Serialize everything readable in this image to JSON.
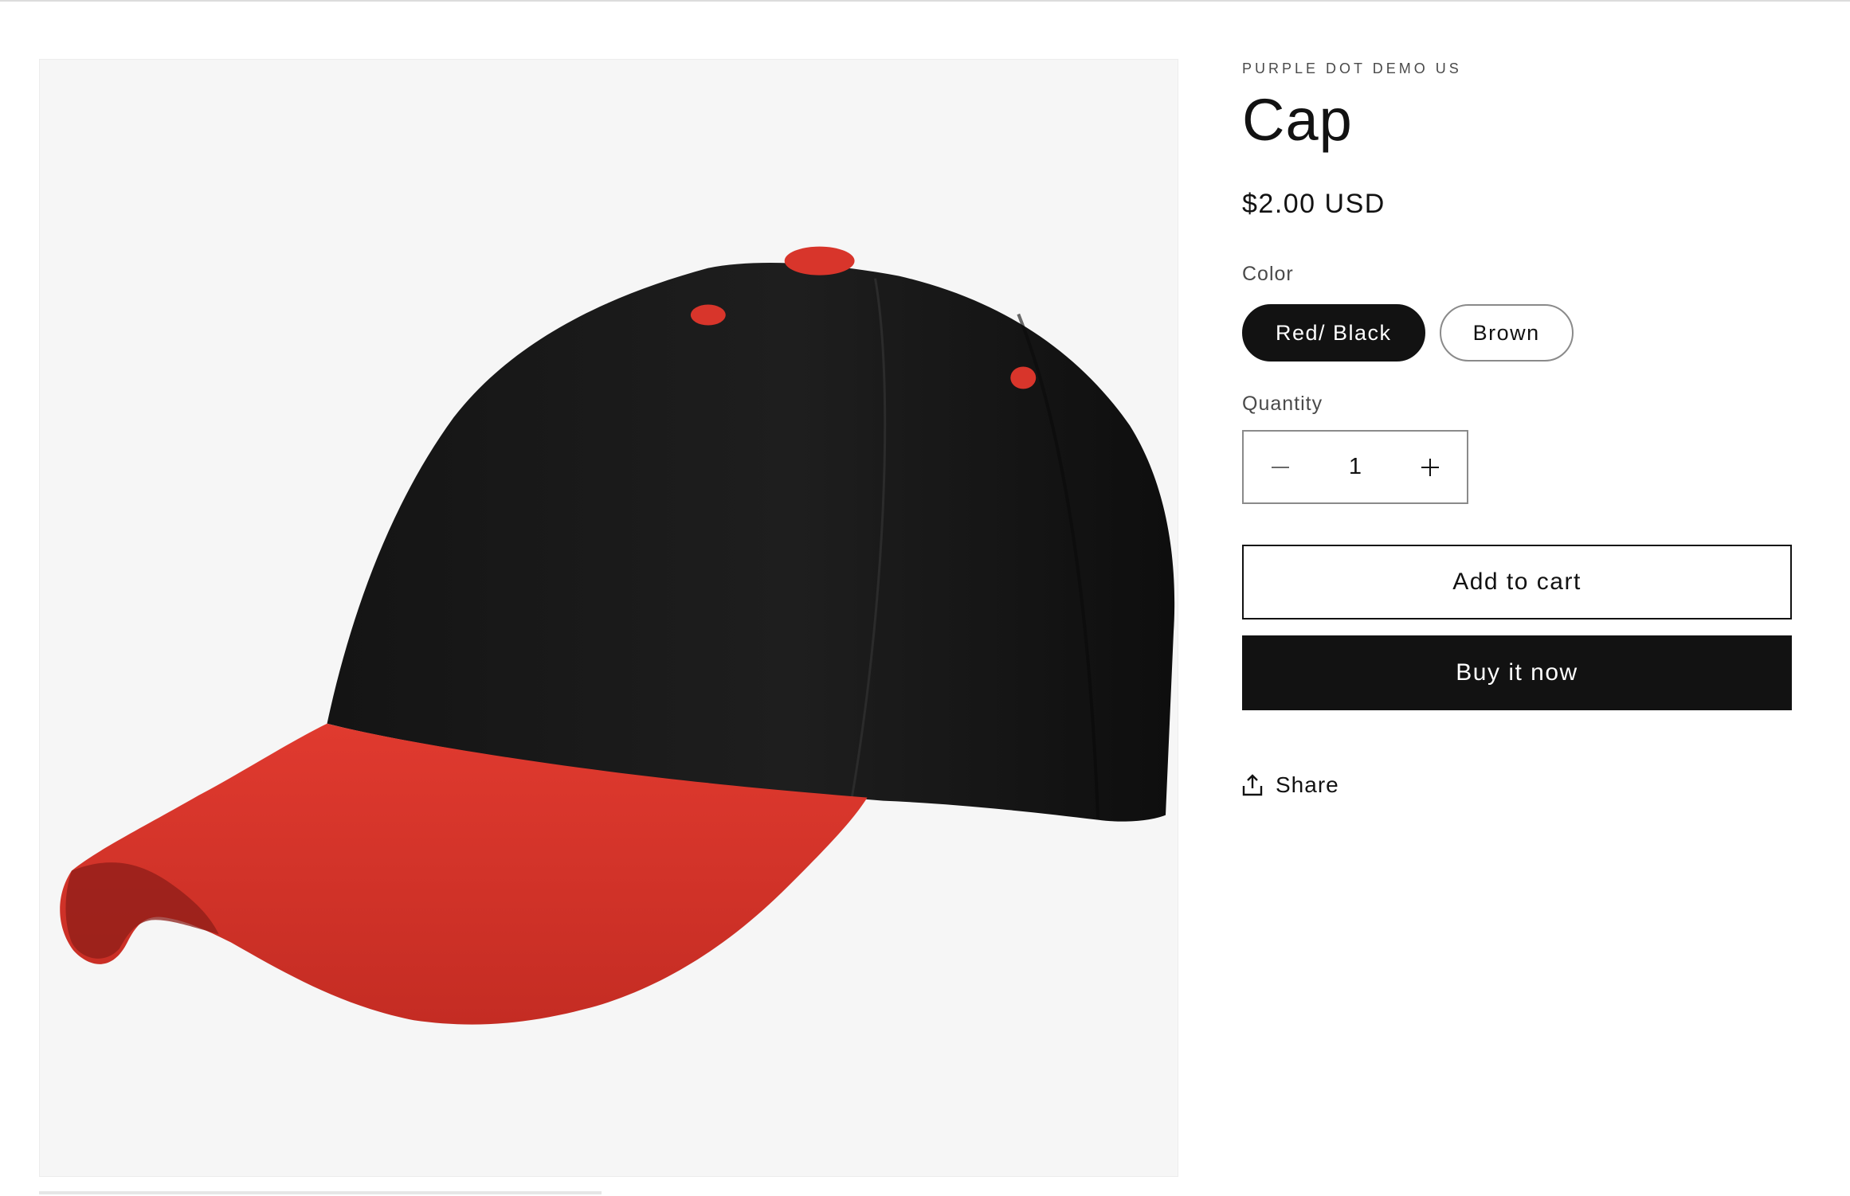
{
  "product": {
    "vendor": "PURPLE DOT DEMO US",
    "title": "Cap",
    "price": "$2.00 USD",
    "image_alt": "Black cap with red brim"
  },
  "color_picker": {
    "label": "Color",
    "options": [
      "Red/ Black",
      "Brown"
    ],
    "selected": "Red/ Black"
  },
  "quantity": {
    "label": "Quantity",
    "value": "1",
    "decrease_icon": "minus-icon",
    "increase_icon": "plus-icon"
  },
  "actions": {
    "add_to_cart": "Add to cart",
    "buy_now": "Buy it now",
    "share": "Share",
    "share_icon": "share-upload-icon"
  },
  "colors": {
    "text": "#121212",
    "muted": "#4a4a4a",
    "border": "#8a8a8a",
    "media_bg": "#f6f6f6",
    "cap_crown": "#1a1a1a",
    "cap_brim": "#d8352b"
  }
}
